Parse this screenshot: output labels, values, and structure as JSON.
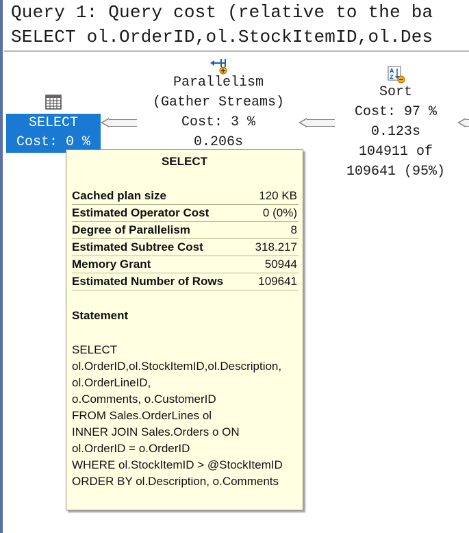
{
  "header": {
    "line1": "Query 1: Query cost (relative to the ba",
    "line2": "SELECT ol.OrderID,ol.StockItemID,ol.Des"
  },
  "nodes": {
    "select": {
      "icon": "table-grid-icon",
      "label": "SELECT",
      "cost": "Cost: 0 %"
    },
    "parallelism": {
      "icon": "parallelism-icon",
      "label": "Parallelism",
      "sublabel": "(Gather Streams)",
      "cost": "Cost: 3 %",
      "time": "0.206s"
    },
    "sort": {
      "icon": "sort-icon",
      "label": "Sort",
      "cost": "Cost: 97 %",
      "time": "0.123s",
      "rows_line1": "104911 of",
      "rows_line2": "109641 (95%)"
    }
  },
  "tooltip": {
    "title": "SELECT",
    "properties": [
      {
        "key": "Cached plan size",
        "value": "120 KB"
      },
      {
        "key": "Estimated Operator Cost",
        "value": "0 (0%)"
      },
      {
        "key": "Degree of Parallelism",
        "value": "8"
      },
      {
        "key": "Estimated Subtree Cost",
        "value": "318.217"
      },
      {
        "key": "Memory Grant",
        "value": "50944"
      },
      {
        "key": "Estimated Number of Rows",
        "value": "109641"
      }
    ],
    "statement_heading": "Statement",
    "statement": "SELECT\nol.OrderID,ol.StockItemID,ol.Description,\nol.OrderLineID,\no.Comments, o.CustomerID\nFROM Sales.OrderLines ol\nINNER JOIN Sales.Orders o ON\nol.OrderID = o.OrderID\nWHERE ol.StockItemID > @StockItemID\nORDER BY ol.Description, o.Comments"
  },
  "colors": {
    "selected_node": "#1979d3",
    "tooltip_bg": "#ffffe1",
    "arrow": "#888888"
  }
}
